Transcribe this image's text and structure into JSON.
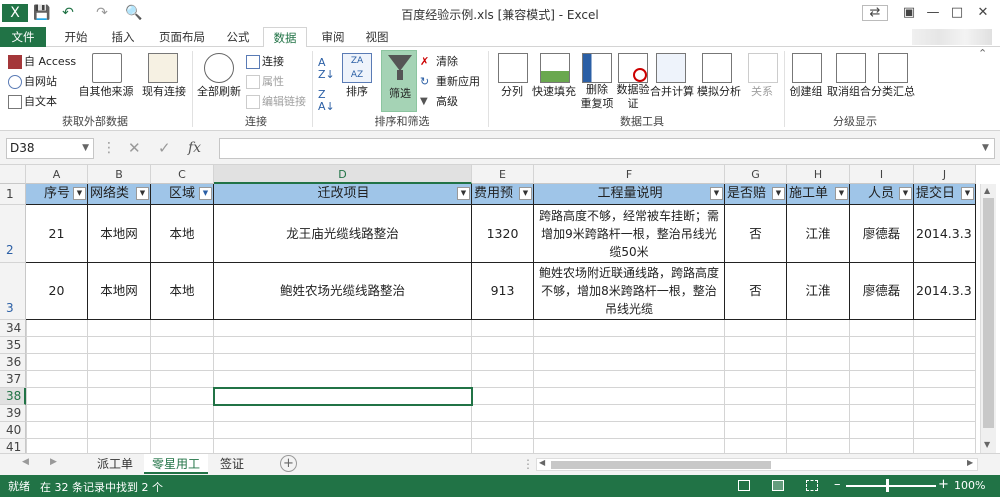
{
  "window": {
    "title": "百度经验示例.xls [兼容模式] - Excel"
  },
  "tabs": [
    "文件",
    "开始",
    "插入",
    "页面布局",
    "公式",
    "数据",
    "审阅",
    "视图"
  ],
  "ribbon": {
    "get_external": {
      "access": "自 Access",
      "web": "自网站",
      "text": "自文本",
      "other": "自其他来源",
      "existing": "现有连接",
      "label": "获取外部数据"
    },
    "connections": {
      "refresh_all": "全部刷新",
      "connections": "连接",
      "properties": "属性",
      "edit_links": "编辑链接",
      "label": "连接"
    },
    "sort_filter": {
      "sort": "排序",
      "filter": "筛选",
      "clear": "清除",
      "reapply": "重新应用",
      "advanced": "高级",
      "label": "排序和筛选"
    },
    "data_tools": {
      "split": "分列",
      "flash_fill": "快速填充",
      "remove_dup": "删除\n重复项",
      "validation": "数据验\n证",
      "consolidate": "合并计算",
      "whatif": "模拟分析",
      "relations": "关系",
      "label": "数据工具"
    },
    "outline": {
      "group": "创建组",
      "ungroup": "取消组合",
      "subtotal": "分类汇总",
      "label": "分级显示"
    }
  },
  "formula_bar": {
    "name_box": "D38",
    "formula": ""
  },
  "columns": [
    "A",
    "B",
    "C",
    "D",
    "E",
    "F",
    "G",
    "H",
    "I",
    "J"
  ],
  "header_row": [
    "序号",
    "网络类",
    "区域",
    "迁改项目",
    "费用预",
    "工程量说明",
    "是否赔",
    "施工单",
    "人员",
    "提交日"
  ],
  "rows": [
    {
      "num": "2",
      "cells": [
        "21",
        "本地网",
        "本地",
        "龙王庙光缆线路整治",
        "1320",
        "跨路高度不够，经常被车挂断；需增加9米跨路杆一根，整治吊线光缆50米",
        "否",
        "江淮",
        "廖德磊",
        "2014.3.3"
      ]
    },
    {
      "num": "3",
      "cells": [
        "20",
        "本地网",
        "本地",
        "鲍姓农场光缆线路整治",
        "913",
        "鲍姓农场附近联通线路，跨路高度不够，增加8米跨路杆一根，整治吊线光缆",
        "否",
        "江淮",
        "廖德磊",
        "2014.3.3"
      ]
    }
  ],
  "empty_rows": [
    "34",
    "35",
    "36",
    "37",
    "38",
    "39",
    "40",
    "41"
  ],
  "sheets": [
    "派工单",
    "零星用工",
    "签证"
  ],
  "status": {
    "text": "在 32 条记录中找到 2 个",
    "zoom": "100%"
  }
}
